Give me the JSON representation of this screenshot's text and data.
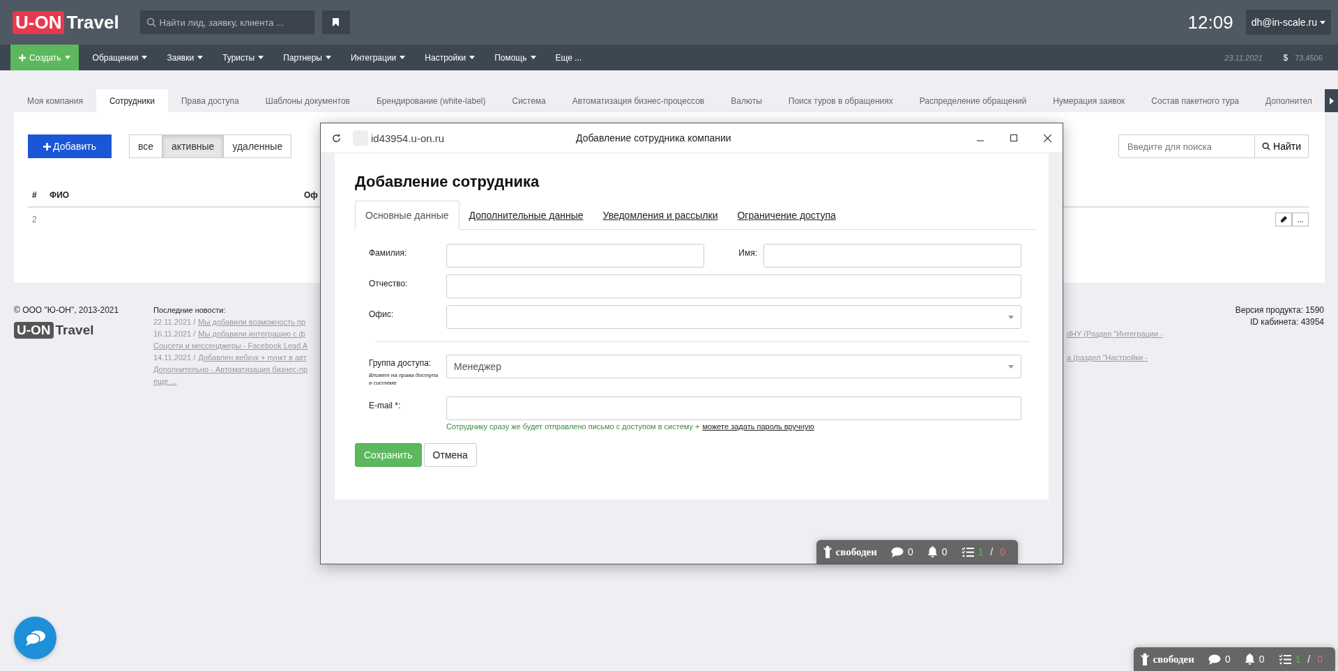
{
  "header": {
    "logo_mark": "U-ON",
    "logo_text": "Travel",
    "search": {
      "placeholder": "Найти лид, заявку, клиента ..."
    },
    "time": "12:09",
    "user": "dh@in-scale.ru"
  },
  "nav": {
    "create": "Создать",
    "items": [
      "Обращения",
      "Заявки",
      "Туристы",
      "Партнеры",
      "Интеграции",
      "Настройки",
      "Помощь"
    ],
    "more": "Еще ...",
    "date": "23.11.2021",
    "currency": "$",
    "rate": "73.4506"
  },
  "tabs": [
    {
      "label": "Моя компания",
      "selected": false
    },
    {
      "label": "Сотрудники",
      "selected": true
    },
    {
      "label": "Права доступа",
      "selected": false
    },
    {
      "label": "Шаблоны документов",
      "selected": false
    },
    {
      "label": "Брендирование (white-label)",
      "selected": false
    },
    {
      "label": "Система",
      "selected": false
    },
    {
      "label": "Автоматизация бизнес-процессов",
      "selected": false
    },
    {
      "label": "Валюты",
      "selected": false
    },
    {
      "label": "Поиск туров в обращениях",
      "selected": false
    },
    {
      "label": "Распределение обращений",
      "selected": false
    },
    {
      "label": "Нумерация заявок",
      "selected": false
    },
    {
      "label": "Состав пакетного тура",
      "selected": false
    },
    {
      "label": "Дополнител",
      "selected": false
    }
  ],
  "toolbar": {
    "add": "Добавить",
    "filters": [
      {
        "label": "все",
        "selected": false
      },
      {
        "label": "активные",
        "selected": true
      },
      {
        "label": "удаленные",
        "selected": false
      }
    ],
    "search": {
      "placeholder": "Введите для поиска"
    },
    "search_button": "Найти"
  },
  "table": {
    "columns": [
      "#",
      "ФИО",
      "Оф"
    ],
    "rows": [
      {
        "number": "2",
        "more": "..."
      }
    ]
  },
  "footer": {
    "copyright": "© ООО \"Ю-ОН\", 2013-2021",
    "logo_mark": "U-ON",
    "logo_text": "Travel",
    "news_title": "Последние новости:",
    "news": [
      {
        "date": "22.11.2021 /",
        "link": "Мы добавили возможность пр"
      },
      {
        "date": "16.11.2021 /",
        "link": "Мы добавили интеграцию с ф",
        "tail": "dHY (Раздел \"Интеграции -"
      },
      {
        "link": "Соцсети и мессенджеры - Facebook Lead A"
      },
      {
        "date": "14.11.2021 /",
        "link": "Добавлен вебхук + пункт в авт",
        "tail": "а (раздел \"Настройки -"
      },
      {
        "link": "Дополнительно - Автоматизация бизнес-пр"
      },
      {
        "link": "еще ..."
      }
    ],
    "version": "Версия продукта: 1590",
    "cabinet": "ID кабинета: 43954"
  },
  "modal": {
    "url": "id43954.u-on.ru",
    "title": "Добавление сотрудника компании",
    "heading": "Добавление сотрудника",
    "tabs": [
      {
        "label": "Основные данные",
        "selected": true
      },
      {
        "label": "Дополнительные данные",
        "selected": false
      },
      {
        "label": "Уведомления и рассылки",
        "selected": false
      },
      {
        "label": "Ограничение доступа",
        "selected": false
      }
    ],
    "last_name": "Фамилия:",
    "first_name": "Имя:",
    "middle_name": "Отчество:",
    "office": "Офис:",
    "group": {
      "label": "Группа доступа:",
      "note": "Влияет на права доступа в системе",
      "value": "Менеджер"
    },
    "email": "E-mail *:",
    "hint": "Сотруднику сразу же будет отправлено письмо с доступом в систему +",
    "hint_link": "можете задать пароль вручную",
    "save": "Сохранить",
    "cancel": "Отмена"
  },
  "status_bars": [
    {
      "status": "свободен",
      "messages": "0",
      "notifications": "0",
      "done": "1",
      "separator": "/",
      "overdue": "0"
    },
    {
      "status": "свободен",
      "messages": "0",
      "notifications": "0",
      "done": "1",
      "separator": "/",
      "overdue": "0"
    }
  ]
}
